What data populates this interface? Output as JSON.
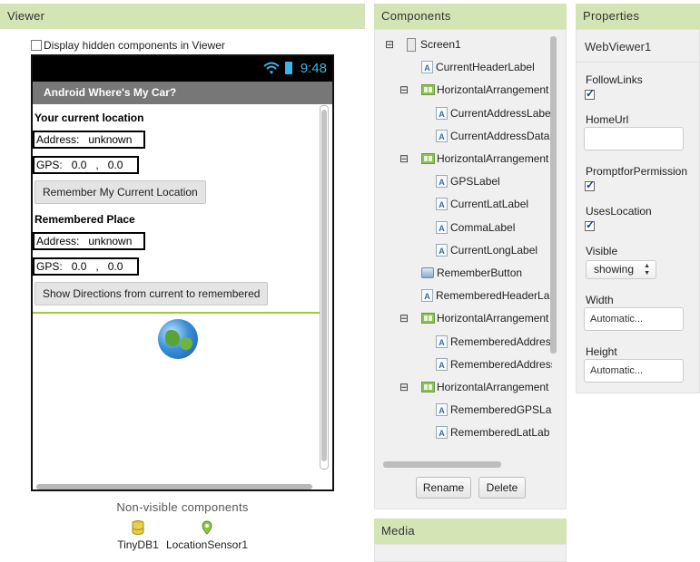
{
  "viewer": {
    "title": "Viewer",
    "hidden_checkbox_label": "Display hidden components in Viewer",
    "phone": {
      "time": "9:48",
      "app_title": "Android Where's My Car?",
      "current_header": "Your current location",
      "current_address_label": "Address:",
      "current_address_value": "unknown",
      "gps_label": "GPS:",
      "current_lat": "0.0",
      "comma": ",",
      "current_long": "0.0",
      "remember_button": "Remember My Current Location",
      "remembered_header": "Remembered Place",
      "remembered_address_label": "Address:",
      "remembered_address_value": "unknown",
      "remembered_gps_label": "GPS:",
      "remembered_lat": "0.0",
      "remembered_comma": ",",
      "remembered_long": "0.0",
      "directions_button": "Show Directions from current to remembered"
    },
    "nonvisible_title": "Non-visible components",
    "nonvisible": [
      "TinyDB1",
      "LocationSensor1"
    ]
  },
  "components": {
    "title": "Components",
    "tree": [
      {
        "label": "Screen1",
        "icon": "screen-icon",
        "toggle": "⊟"
      },
      {
        "label": "CurrentHeaderLabel",
        "icon": "label-icon"
      },
      {
        "label": "HorizontalArrangement",
        "icon": "horizontal-arrangement-icon",
        "toggle": "⊟"
      },
      {
        "label": "CurrentAddressLabel",
        "icon": "label-icon"
      },
      {
        "label": "CurrentAddressData",
        "icon": "label-icon"
      },
      {
        "label": "HorizontalArrangement",
        "icon": "horizontal-arrangement-icon",
        "toggle": "⊟"
      },
      {
        "label": "GPSLabel",
        "icon": "label-icon"
      },
      {
        "label": "CurrentLatLabel",
        "icon": "label-icon"
      },
      {
        "label": "CommaLabel",
        "icon": "label-icon"
      },
      {
        "label": "CurrentLongLabel",
        "icon": "label-icon"
      },
      {
        "label": "RememberButton",
        "icon": "button-icon"
      },
      {
        "label": "RememberedHeaderLa",
        "icon": "label-icon"
      },
      {
        "label": "HorizontalArrangement",
        "icon": "horizontal-arrangement-icon",
        "toggle": "⊟"
      },
      {
        "label": "RememberedAddress",
        "icon": "label-icon"
      },
      {
        "label": "RememberedAddress",
        "icon": "label-icon"
      },
      {
        "label": "HorizontalArrangement",
        "icon": "horizontal-arrangement-icon",
        "toggle": "⊟"
      },
      {
        "label": "RememberedGPSLa",
        "icon": "label-icon"
      },
      {
        "label": "RememberedLatLab",
        "icon": "label-icon"
      }
    ],
    "rename_button": "Rename",
    "delete_button": "Delete"
  },
  "media": {
    "title": "Media"
  },
  "properties": {
    "title": "Properties",
    "component": "WebViewer1",
    "follow_links": "FollowLinks",
    "home_url": "HomeUrl",
    "home_url_value": "",
    "prompt_for_permission": "PromptforPermission",
    "uses_location": "UsesLocation",
    "visible": "Visible",
    "visible_value": "showing",
    "width": "Width",
    "width_value": "Automatic...",
    "height": "Height",
    "height_value": "Automatic..."
  }
}
